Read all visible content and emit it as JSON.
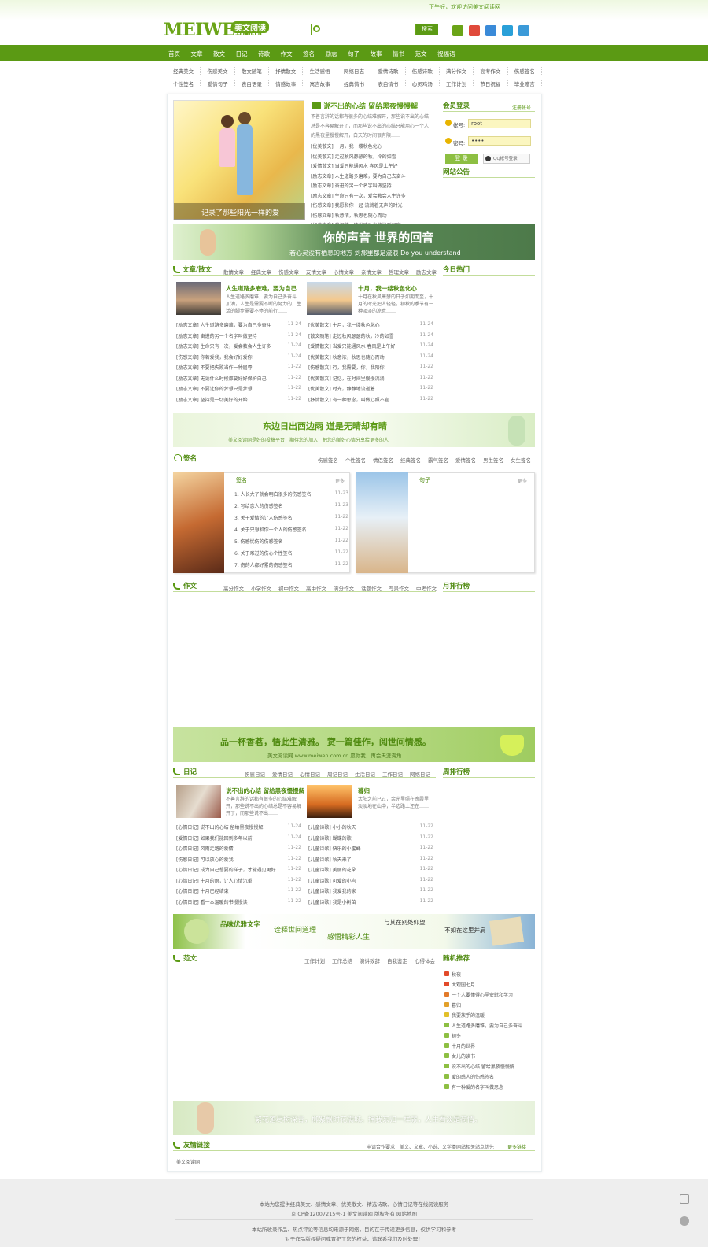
{
  "header": {
    "greeting": "下午好，欢迎访问美文阅读网",
    "logo_word": "MEIWEN",
    "logo_cn": "美文阅读",
    "logo_domain": ".com.cn",
    "search_button": "搜索",
    "search_placeholder": ""
  },
  "nav": [
    "首页",
    "文章",
    "散文",
    "日记",
    "诗歌",
    "作文",
    "签名",
    "励志",
    "句子",
    "故事",
    "情书",
    "范文",
    "祝福语"
  ],
  "subnav": {
    "row1": [
      "经典美文",
      "伤感美文",
      "散文随笔",
      "抒情散文",
      "生活感悟",
      "网络日志",
      "爱情诗歌",
      "伤感诗歌",
      "满分作文",
      "高考作文",
      "伤感签名"
    ],
    "row2": [
      "个性签名",
      "爱情句子",
      "表白语录",
      "情感故事",
      "寓言故事",
      "经典情书",
      "表白情书",
      "心灵鸡汤",
      "工作计划",
      "节日祝福",
      "毕业赠言"
    ]
  },
  "feature": {
    "photo_caption": "记录了那些阳光一样的爱",
    "title": "说不出的心结 留给黑夜慢慢解",
    "intro": "不善言辞的话都有很多的心结难解开，那些说不出的心结总是不容易解开了，而那些说不出的心结只能用心一个人的黑夜里慢慢解开，白天的时间很有限……",
    "links": [
      "[优美散文] 十月，我一缕秋色化心",
      "[优美散文] 走过秋风瑟瑟的秋，冷的如雪",
      "[爱情散文] 当爱只能通风水 春风是上午好",
      "[励志文章] 人生道路多磨难，要为自己去奋斗",
      "[励志文章] 奋进的另一个名字叫做坚持",
      "[励志文章] 生命只有一次，爱会教会人生许多",
      "[伤感文章] 我愿和你一起 流淌着无声的时光",
      "[伤感文章] 秋意浓，秋思也随心而动",
      "[经典文章] 我相信，这份感动也能找到归宿"
    ]
  },
  "login": {
    "title": "会员登录",
    "register": "注册帐号",
    "user_label": "帐号:",
    "user_value": "root",
    "pass_label": "密码:",
    "pass_value": "••••",
    "login_button": "登 录",
    "qq_button": "QQ帐号登录",
    "notice_title": "网站公告"
  },
  "banner1": {
    "line1": "你的声音 世界的回音",
    "line2": "若心灵没有栖息的地方 到那里都是流浪 Do you understand"
  },
  "articles": {
    "title": "文章/散文",
    "tabs": [
      "散情文章",
      "经典文章",
      "伤感文章",
      "友情文章",
      "心情文章",
      "亲情文章",
      "哲理文章",
      "励志文章"
    ],
    "hot_title": "今日热门",
    "top": [
      {
        "title": "人生道路多磨难，要为自己",
        "desc": "人生道路多磨难，要为自己多奋斗 加油，人生是需要不断的努力的，生活的脚步需要不停的前行……"
      },
      {
        "title": "十月，我一缕秋色化心",
        "desc": "十月在秋风萧瑟的日子如期而至，十月的时光把人轻轻，初秋的季节有一种淡淡的凉意……"
      }
    ],
    "left": [
      [
        "[励志文章] 人生道路多磨难，要为自己多奋斗",
        "11-24"
      ],
      [
        "[励志文章] 奋进的另一个名字叫做坚持",
        "11-24"
      ],
      [
        "[励志文章] 生命只有一次，爱会教会人生许多",
        "11-24"
      ],
      [
        "[伤感文章] 你若爱我，我会好好爱你",
        "11-24"
      ],
      [
        "[励志文章] 不要把失败当作一种屈辱",
        "11-22"
      ],
      [
        "[励志文章] 无论什么时候都要好好保护自己",
        "11-22"
      ],
      [
        "[励志文章] 不要让你的梦想只是梦想",
        "11-22"
      ],
      [
        "[励志文章] 坚持是一切美好的开始",
        "11-22"
      ]
    ],
    "right": [
      [
        "[优美散文] 十月，我一缕秋色化心",
        "11-24"
      ],
      [
        "[散文随笔] 走过秋风瑟瑟的秋，冷的如雪",
        "11-24"
      ],
      [
        "[爱情散文] 当爱只能通风水 春风是上午好",
        "11-24"
      ],
      [
        "[优美散文] 秋意浓，秋思也随心而动",
        "11-24"
      ],
      [
        "[伤感散文] 行，我需要，你，我陪你",
        "11-22"
      ],
      [
        "[优美散文] 记忆，在时间里慢慢流淌",
        "11-22"
      ],
      [
        "[优美散文] 时光，静静地流逝着",
        "11-22"
      ],
      [
        "[抒情散文] 有一种思念，叫做心照不宣",
        "11-22"
      ]
    ]
  },
  "banner2": {
    "line1": "东边日出西边雨  道是无晴却有晴",
    "line2": "美文阅读网是好的投稿平台，期待您的加入，把您的美好心情分享给更多的人"
  },
  "sign": {
    "title": "签名",
    "tabs": [
      "伤感签名",
      "个性签名",
      "情侣签名",
      "经典签名",
      "霸气签名",
      "爱情签名",
      "男生签名",
      "女生签名"
    ],
    "left_label": "签名",
    "left_more": "更多",
    "right_label": "句子",
    "right_more": "更多",
    "items": [
      [
        "1.",
        "人长大了就会明白很多的伤感签名",
        "11-23"
      ],
      [
        "2.",
        "写给恋人的伤感签名",
        "11-23"
      ],
      [
        "3.",
        "关于爱情的让人伤感签名",
        "11-22"
      ],
      [
        "4.",
        "关于只想和你一个人的伤感签名",
        "11-22"
      ],
      [
        "5.",
        "伤感忧伤的伤感签名",
        "11-22"
      ],
      [
        "6.",
        "关于难过的伤心个性签名",
        "11-22"
      ],
      [
        "7.",
        "伤的人都好累的伤感签名",
        "11-22"
      ]
    ]
  },
  "essay": {
    "title": "作文",
    "tabs": [
      "高分作文",
      "小学作文",
      "初中作文",
      "高中作文",
      "满分作文",
      "话题作文",
      "写景作文",
      "中考作文"
    ],
    "rank_title": "月排行榜"
  },
  "banner3": {
    "line1": "品一杯香茗，悟此生清雅。 赏一篇佳作，阅世间情感。",
    "line2": "美文阅读网 www.meiwen.com.cn 愿你我，再会天涯海角"
  },
  "diary": {
    "title": "日记",
    "tabs": [
      "伤感日记",
      "爱情日记",
      "心情日记",
      "周记日记",
      "生活日记",
      "工作日记",
      "网络日记"
    ],
    "rank_title": "周排行榜",
    "top": [
      {
        "title": "说不出的心结 留给黑夜慢慢解",
        "desc": "不善言辞的话都有很多的心结难解开，那些说不出的心结总是不容易解开了，而那些说不出……"
      },
      {
        "title": "暮归",
        "desc": "太阳之前已过，余光里照在晚霞里，淡淡地在山中，半边路上还在……"
      }
    ],
    "left": [
      [
        "[心情日记] 说不出的心结 留给黑夜慢慢解",
        "11-24"
      ],
      [
        "[爱情日记] 如果我们能回到多年以前",
        "11-24"
      ],
      [
        "[心情日记] 风雨走路的爱情",
        "11-22"
      ],
      [
        "[伤感日记] 可以放心的爱我",
        "11-22"
      ],
      [
        "[心情日记] 成为自己想要的样子，才能遇见更好",
        "11-22"
      ],
      [
        "[心情日记] 十月的雨，让人心情沉重",
        "11-22"
      ],
      [
        "[心情日记] 十月已经结束",
        "11-22"
      ],
      [
        "[心情日记] 看一本温暖的书慢慢读",
        "11-22"
      ]
    ],
    "right": [
      [
        "[儿童诗歌] 小小的秋天",
        "11-22"
      ],
      [
        "[儿童诗歌] 蝴蝶的歌",
        "11-22"
      ],
      [
        "[儿童诗歌] 快乐的小蜜蜂",
        "11-22"
      ],
      [
        "[儿童诗歌] 秋天来了",
        "11-22"
      ],
      [
        "[儿童诗歌] 美丽的花朵",
        "11-22"
      ],
      [
        "[儿童诗歌] 可爱的小鸟",
        "11-22"
      ],
      [
        "[儿童诗歌] 我爱我的家",
        "11-22"
      ],
      [
        "[儿童诗歌] 我是小树苗",
        "11-22"
      ]
    ]
  },
  "banner4": {
    "a": "品味优雅文字",
    "b": "诠释世间道理",
    "c": "感悟精彩人生",
    "d": "与其在别处仰望",
    "e": "不如在这里并肩"
  },
  "fanwen": {
    "title": "范文",
    "tabs": [
      "工作计划",
      "工作总结",
      "演讲致辞",
      "自我鉴定",
      "心得体会"
    ],
    "random_title": "随机推荐",
    "random": [
      "秋夜",
      "大观园七月",
      "一个人要懂得心里安慰和学习",
      "暮归",
      "我要放手的温暖",
      "人生道路多磨难，要为自己多奋斗",
      "初冬",
      "十月的世界",
      "女儿的读书",
      "说不出的心结 留给黑夜慢慢解",
      "爱的感人的伤感签名",
      "有一种爱的名字叫做思念"
    ]
  },
  "banner5": {
    "text": "繁花落尽树深青，柳絮飘时花满城。拥我东归一样景，人生看淡是荷情。"
  },
  "links": {
    "title": "友情链接",
    "note": "申请合作要求：美文、文章、小说、文学类网站相关站点优先",
    "apply": "更多链接",
    "items": [
      "美文阅读网"
    ]
  },
  "footer": {
    "line1": "本站为您提供经典美文、感情文章、优美散文、精选诗歌、心情日记等在线阅读服务",
    "line2": "京ICP备12007215号-1 美文阅读网 版权所有 网站地图",
    "line3": "本站所收录作品、热点评论等信息均来源于网络，目的在于传递更多信息，仅供学习和参考",
    "line4": "对于作品版权疑问或冒犯了您的权益，请联系我们及时处理！"
  },
  "colors": {
    "brand": "#5b9a14",
    "title_green": "#4f8a10",
    "link_gray": "#555555"
  }
}
